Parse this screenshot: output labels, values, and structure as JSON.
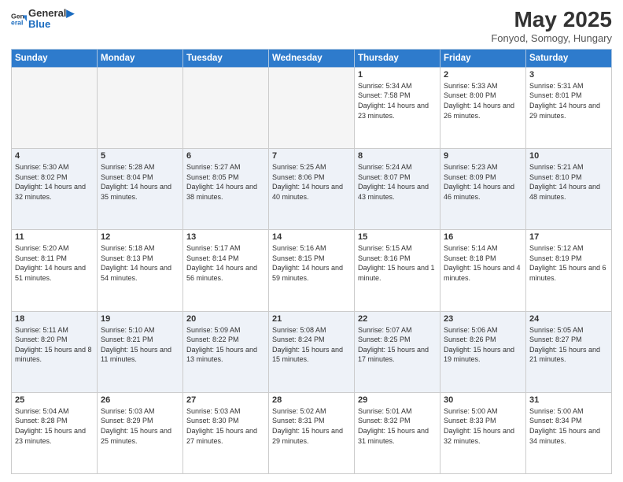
{
  "header": {
    "logo_line1": "General",
    "logo_line2": "Blue",
    "title": "May 2025",
    "subtitle": "Fonyod, Somogy, Hungary"
  },
  "days_of_week": [
    "Sunday",
    "Monday",
    "Tuesday",
    "Wednesday",
    "Thursday",
    "Friday",
    "Saturday"
  ],
  "weeks": [
    [
      {
        "day": "",
        "empty": true
      },
      {
        "day": "",
        "empty": true
      },
      {
        "day": "",
        "empty": true
      },
      {
        "day": "",
        "empty": true
      },
      {
        "day": "1",
        "sunrise": "5:34 AM",
        "sunset": "7:58 PM",
        "daylight": "14 hours and 23 minutes."
      },
      {
        "day": "2",
        "sunrise": "5:33 AM",
        "sunset": "8:00 PM",
        "daylight": "14 hours and 26 minutes."
      },
      {
        "day": "3",
        "sunrise": "5:31 AM",
        "sunset": "8:01 PM",
        "daylight": "14 hours and 29 minutes."
      }
    ],
    [
      {
        "day": "4",
        "sunrise": "5:30 AM",
        "sunset": "8:02 PM",
        "daylight": "14 hours and 32 minutes."
      },
      {
        "day": "5",
        "sunrise": "5:28 AM",
        "sunset": "8:04 PM",
        "daylight": "14 hours and 35 minutes."
      },
      {
        "day": "6",
        "sunrise": "5:27 AM",
        "sunset": "8:05 PM",
        "daylight": "14 hours and 38 minutes."
      },
      {
        "day": "7",
        "sunrise": "5:25 AM",
        "sunset": "8:06 PM",
        "daylight": "14 hours and 40 minutes."
      },
      {
        "day": "8",
        "sunrise": "5:24 AM",
        "sunset": "8:07 PM",
        "daylight": "14 hours and 43 minutes."
      },
      {
        "day": "9",
        "sunrise": "5:23 AM",
        "sunset": "8:09 PM",
        "daylight": "14 hours and 46 minutes."
      },
      {
        "day": "10",
        "sunrise": "5:21 AM",
        "sunset": "8:10 PM",
        "daylight": "14 hours and 48 minutes."
      }
    ],
    [
      {
        "day": "11",
        "sunrise": "5:20 AM",
        "sunset": "8:11 PM",
        "daylight": "14 hours and 51 minutes."
      },
      {
        "day": "12",
        "sunrise": "5:18 AM",
        "sunset": "8:13 PM",
        "daylight": "14 hours and 54 minutes."
      },
      {
        "day": "13",
        "sunrise": "5:17 AM",
        "sunset": "8:14 PM",
        "daylight": "14 hours and 56 minutes."
      },
      {
        "day": "14",
        "sunrise": "5:16 AM",
        "sunset": "8:15 PM",
        "daylight": "14 hours and 59 minutes."
      },
      {
        "day": "15",
        "sunrise": "5:15 AM",
        "sunset": "8:16 PM",
        "daylight": "15 hours and 1 minute."
      },
      {
        "day": "16",
        "sunrise": "5:14 AM",
        "sunset": "8:18 PM",
        "daylight": "15 hours and 4 minutes."
      },
      {
        "day": "17",
        "sunrise": "5:12 AM",
        "sunset": "8:19 PM",
        "daylight": "15 hours and 6 minutes."
      }
    ],
    [
      {
        "day": "18",
        "sunrise": "5:11 AM",
        "sunset": "8:20 PM",
        "daylight": "15 hours and 8 minutes."
      },
      {
        "day": "19",
        "sunrise": "5:10 AM",
        "sunset": "8:21 PM",
        "daylight": "15 hours and 11 minutes."
      },
      {
        "day": "20",
        "sunrise": "5:09 AM",
        "sunset": "8:22 PM",
        "daylight": "15 hours and 13 minutes."
      },
      {
        "day": "21",
        "sunrise": "5:08 AM",
        "sunset": "8:24 PM",
        "daylight": "15 hours and 15 minutes."
      },
      {
        "day": "22",
        "sunrise": "5:07 AM",
        "sunset": "8:25 PM",
        "daylight": "15 hours and 17 minutes."
      },
      {
        "day": "23",
        "sunrise": "5:06 AM",
        "sunset": "8:26 PM",
        "daylight": "15 hours and 19 minutes."
      },
      {
        "day": "24",
        "sunrise": "5:05 AM",
        "sunset": "8:27 PM",
        "daylight": "15 hours and 21 minutes."
      }
    ],
    [
      {
        "day": "25",
        "sunrise": "5:04 AM",
        "sunset": "8:28 PM",
        "daylight": "15 hours and 23 minutes."
      },
      {
        "day": "26",
        "sunrise": "5:03 AM",
        "sunset": "8:29 PM",
        "daylight": "15 hours and 25 minutes."
      },
      {
        "day": "27",
        "sunrise": "5:03 AM",
        "sunset": "8:30 PM",
        "daylight": "15 hours and 27 minutes."
      },
      {
        "day": "28",
        "sunrise": "5:02 AM",
        "sunset": "8:31 PM",
        "daylight": "15 hours and 29 minutes."
      },
      {
        "day": "29",
        "sunrise": "5:01 AM",
        "sunset": "8:32 PM",
        "daylight": "15 hours and 31 minutes."
      },
      {
        "day": "30",
        "sunrise": "5:00 AM",
        "sunset": "8:33 PM",
        "daylight": "15 hours and 32 minutes."
      },
      {
        "day": "31",
        "sunrise": "5:00 AM",
        "sunset": "8:34 PM",
        "daylight": "15 hours and 34 minutes."
      }
    ]
  ],
  "labels": {
    "sunrise_prefix": "Sunrise: ",
    "sunset_prefix": "Sunset: ",
    "daylight_prefix": "Daylight: "
  }
}
